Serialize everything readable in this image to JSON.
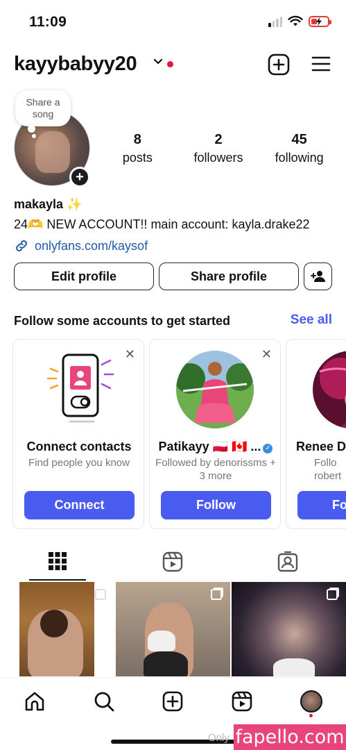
{
  "status_bar": {
    "time": "11:09",
    "battery_level": 0.35
  },
  "header": {
    "username": "kayybabyy20"
  },
  "profile": {
    "note_text": "Share a song",
    "stats": [
      {
        "value": "8",
        "label": "posts"
      },
      {
        "value": "2",
        "label": "followers"
      },
      {
        "value": "45",
        "label": "following"
      }
    ],
    "name": "makayla ✨",
    "bio": "24🫶 NEW ACCOUNT!! main account: kayla.drake22",
    "link": "onlyfans.com/kaysof"
  },
  "buttons": {
    "edit": "Edit profile",
    "share": "Share profile"
  },
  "suggestions": {
    "title": "Follow some accounts to get started",
    "see_all": "See all",
    "cards": [
      {
        "name": "Connect contacts",
        "sub": "Find people you know",
        "button": "Connect"
      },
      {
        "name": "Patikayy 🇵🇱 🇨🇦 ...",
        "sub": "Followed by denorissms + 3 more",
        "button": "Follow"
      },
      {
        "name": "Renee Da",
        "sub": "Follo robert",
        "button": "Fo"
      }
    ]
  },
  "tabs": [
    "grid-tab",
    "reels-tab",
    "tagged-tab"
  ],
  "colors": {
    "accent": "#4a5cf0",
    "link": "#1e5aa8",
    "live_dot": "#e8163a",
    "watermark": "#e8457a"
  },
  "watermark": {
    "text": "fapello.com",
    "faint": "Only"
  }
}
